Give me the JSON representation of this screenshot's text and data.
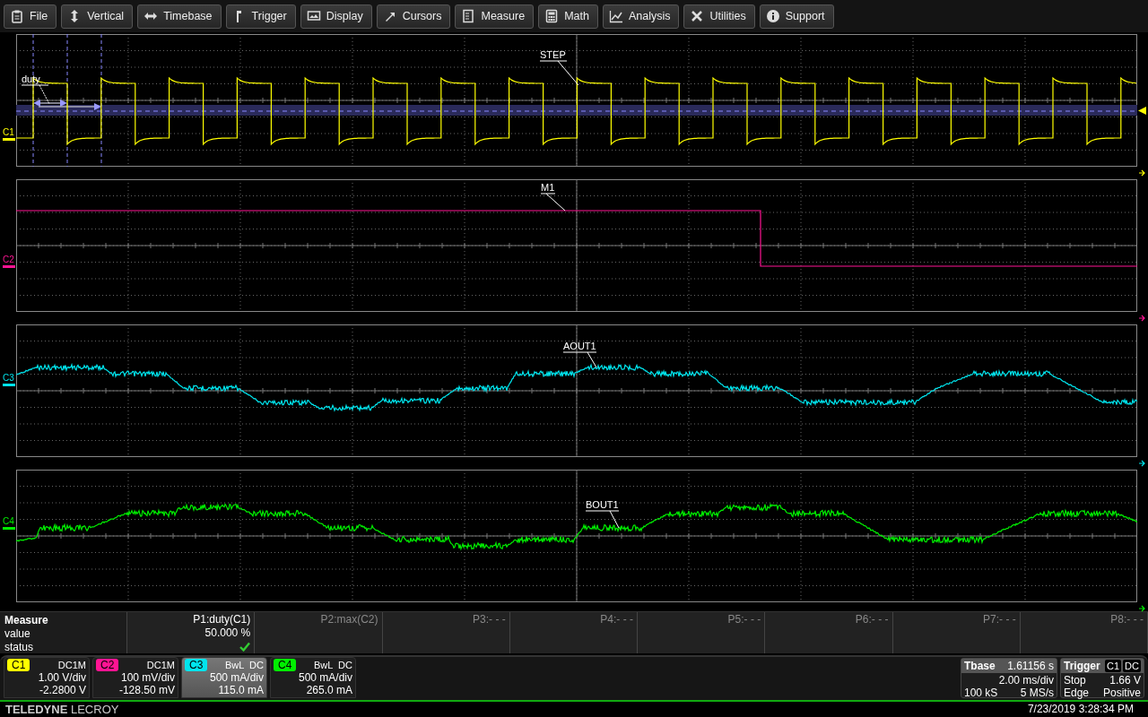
{
  "menu": [
    {
      "label": "File"
    },
    {
      "label": "Vertical"
    },
    {
      "label": "Timebase"
    },
    {
      "label": "Trigger"
    },
    {
      "label": "Display"
    },
    {
      "label": "Cursors"
    },
    {
      "label": "Measure"
    },
    {
      "label": "Math"
    },
    {
      "label": "Analysis"
    },
    {
      "label": "Utilities"
    },
    {
      "label": "Support"
    }
  ],
  "panels": [
    {
      "channel": "C1",
      "color": "#ffff00",
      "annotations": [
        "duty",
        "STEP"
      ]
    },
    {
      "channel": "C2",
      "color": "#ff1493",
      "annotations": [
        "M1"
      ]
    },
    {
      "channel": "C3",
      "color": "#00e5ee",
      "annotations": [
        "AOUT1"
      ]
    },
    {
      "channel": "C4",
      "color": "#00ee00",
      "annotations": [
        "BOUT1"
      ]
    }
  ],
  "measure": {
    "title": "Measure",
    "row_labels": [
      "value",
      "status"
    ],
    "params": [
      {
        "label": "P1:duty(C1)",
        "value": "50.000 %",
        "active": true,
        "status_ok": true
      },
      {
        "label": "P2:max(C2)",
        "active": false,
        "status_ok": false
      },
      {
        "label": "P3:- - -",
        "active": false,
        "status_ok": false
      },
      {
        "label": "P4:- - -",
        "active": false,
        "status_ok": false
      },
      {
        "label": "P5:- - -",
        "active": false,
        "status_ok": false
      },
      {
        "label": "P6:- - -",
        "active": false,
        "status_ok": false
      },
      {
        "label": "P7:- - -",
        "active": false,
        "status_ok": false
      },
      {
        "label": "P8:- - -",
        "active": false,
        "status_ok": false
      }
    ]
  },
  "channels": [
    {
      "name": "C1",
      "color": "#ffff00",
      "coupling": "DC1M",
      "scale": "1.00 V/div",
      "offset": "-2.2800 V",
      "selected": false
    },
    {
      "name": "C2",
      "color": "#ff1493",
      "coupling": "DC1M",
      "scale": "100 mV/div",
      "offset": "-128.50 mV",
      "selected": false
    },
    {
      "name": "C3",
      "color": "#00e5ee",
      "coupling": "BwL  DC",
      "scale": "500 mA/div",
      "offset": "115.0 mA",
      "selected": true
    },
    {
      "name": "C4",
      "color": "#00ee00",
      "coupling": "BwL  DC",
      "scale": "500 mA/div",
      "offset": "265.0 mA",
      "selected": false
    }
  ],
  "timebase": {
    "title": "Tbase",
    "delay": "1.61156 s",
    "scale": "2.00 ms/div",
    "samples": "100 kS",
    "rate": "5 MS/s"
  },
  "trigger": {
    "title": "Trigger",
    "tags": [
      "C1",
      "DC"
    ],
    "rows": [
      [
        "Stop",
        "1.66 V"
      ],
      [
        "Edge",
        "Positive"
      ]
    ]
  },
  "footer": {
    "logo": "**TELEDYNE** LECROY",
    "datetime": "7/23/2019 3:28:34 PM"
  }
}
